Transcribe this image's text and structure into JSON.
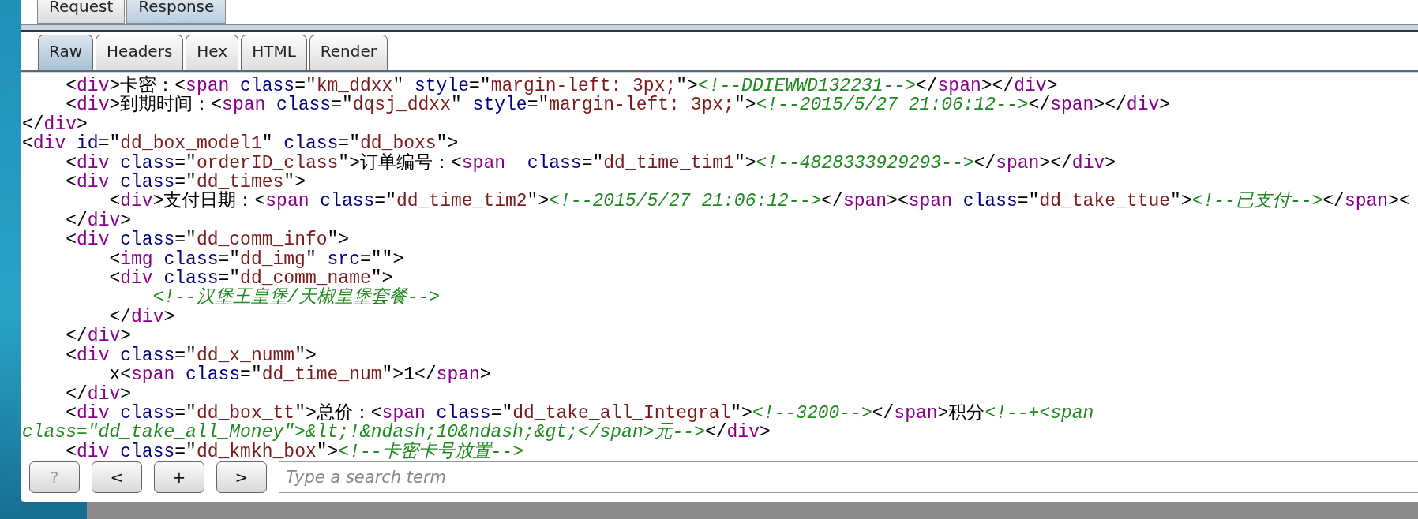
{
  "outer_tabs": [
    {
      "label": "Request",
      "selected": false
    },
    {
      "label": "Response",
      "selected": true
    }
  ],
  "view_tabs": [
    {
      "label": "Raw",
      "selected": true
    },
    {
      "label": "Headers",
      "selected": false
    },
    {
      "label": "Hex",
      "selected": false
    },
    {
      "label": "HTML",
      "selected": false
    },
    {
      "label": "Render",
      "selected": false
    }
  ],
  "code_lines": [
    "    <div>卡密：<span class=\"km_ddxx\" style=\"margin-left: 3px;\"><!--DDIEWWD132231--></span></div>",
    "    <div>到期时间：<span class=\"dqsj_ddxx\" style=\"margin-left: 3px;\"><!--2015/5/27 21:06:12--></span></div>",
    "</div>",
    "<div id=\"dd_box_model1\" class=\"dd_boxs\">",
    "    <div class=\"orderID_class\">订单编号：<span  class=\"dd_time_tim1\"><!--4828333929293--></span></div>",
    "    <div class=\"dd_times\">",
    "        <div>支付日期：<span class=\"dd_time_tim2\"><!--2015/5/27 21:06:12--></span><span class=\"dd_take_ttue\"><!--已支付--></span><",
    "    </div>",
    "    <div class=\"dd_comm_info\">",
    "        <img class=\"dd_img\" src=\"\">",
    "        <div class=\"dd_comm_name\">",
    "            <!--汉堡王皇堡/天椒皇堡套餐-->",
    "        </div>",
    "    </div>",
    "    <div class=\"dd_x_numm\">",
    "        x<span class=\"dd_time_num\">1</span>",
    "    </div>",
    "    <div class=\"dd_box_tt\">总价：<span class=\"dd_take_all_Integral\"><!--3200--></span>积分<!--+<span",
    "class=\"dd_take_all_Money\">&lt;!&ndash;10&ndash;&gt;</span>元--></div>",
    "    <div class=\"dd_kmkh_box\"><!--卡密卡号放置-->"
  ],
  "search_buttons": [
    {
      "label": "?",
      "disabled": true
    },
    {
      "label": "<",
      "disabled": false
    },
    {
      "label": "+",
      "disabled": false
    },
    {
      "label": ">",
      "disabled": false
    }
  ],
  "search": {
    "placeholder": "Type a search term"
  }
}
